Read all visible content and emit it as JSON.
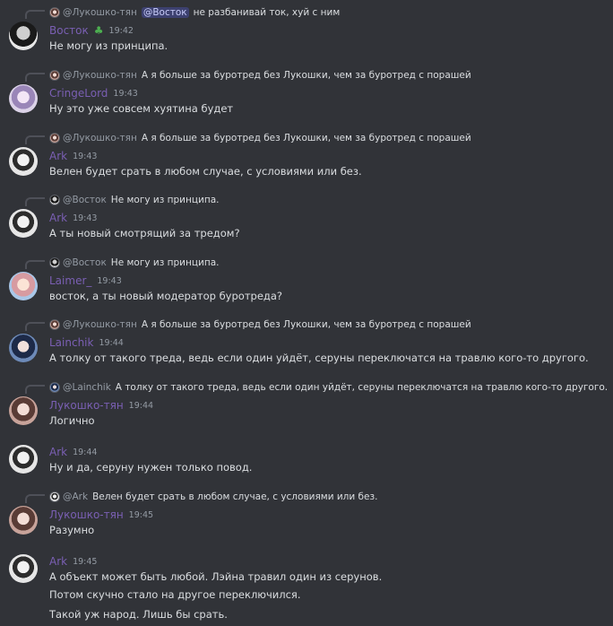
{
  "colors": {
    "background": "#313338",
    "text": "#dbdee1",
    "muted": "#949ba4",
    "username_purple": "#7a5fb3",
    "mention_bg": "#3c4270"
  },
  "messages": [
    {
      "reply": {
        "author": "@Лукошко-тян",
        "mention": "@Восток",
        "text": "не разбанивай ток, хуй с ним"
      },
      "author": "Восток",
      "badge": "♣",
      "time": "19:42",
      "lines": [
        "Не могу из принципа."
      ]
    },
    {
      "reply": {
        "author": "@Лукошко-тян",
        "text": "А я больше за буротред без Лукошки, чем за буротред с порашей"
      },
      "author": "CringeLord",
      "time": "19:43",
      "lines": [
        "Ну это уже совсем хуятина будет"
      ]
    },
    {
      "reply": {
        "author": "@Лукошко-тян",
        "text": "А я больше за буротред без Лукошки, чем за буротред с порашей"
      },
      "author": "Ark",
      "time": "19:43",
      "lines": [
        "Велен будет срать в любом случае, с условиями или без."
      ]
    },
    {
      "reply": {
        "author": "@Восток",
        "text": "Не могу из принципа."
      },
      "author": "Ark",
      "time": "19:43",
      "lines": [
        "А ты новый смотрящий за тредом?"
      ]
    },
    {
      "reply": {
        "author": "@Восток",
        "text": "Не могу из принципа."
      },
      "author": "Laimer_",
      "time": "19:43",
      "lines": [
        "восток, а ты новый модератор буротреда?"
      ]
    },
    {
      "reply": {
        "author": "@Лукошко-тян",
        "text": "А я больше за буротред без Лукошки, чем за буротред с порашей"
      },
      "author": "Lainchik",
      "time": "19:44",
      "lines": [
        "А толку от такого треда, ведь если один уйдёт, серуны переключатся на травлю кого-то другого."
      ]
    },
    {
      "reply": {
        "author": "@Lainchik",
        "text": "А толку от такого треда, ведь если один уйдёт, серуны переключатся на травлю кого-то другого."
      },
      "author": "Лукошко-тян",
      "time": "19:44",
      "lines": [
        "Логично"
      ]
    },
    {
      "author": "Ark",
      "time": "19:44",
      "lines": [
        "Ну и да, серуну нужен только повод."
      ]
    },
    {
      "reply": {
        "author": "@Ark",
        "text": "Велен будет срать в любом случае, с условиями или без."
      },
      "author": "Лукошко-тян",
      "time": "19:45",
      "lines": [
        "Разумно"
      ]
    },
    {
      "author": "Ark",
      "time": "19:45",
      "lines": [
        "А объект может быть любой. Лэйна травил один из серунов.",
        "Потом скучно стало на другое переключился.",
        "Такой уж народ. Лишь бы срать."
      ]
    }
  ]
}
